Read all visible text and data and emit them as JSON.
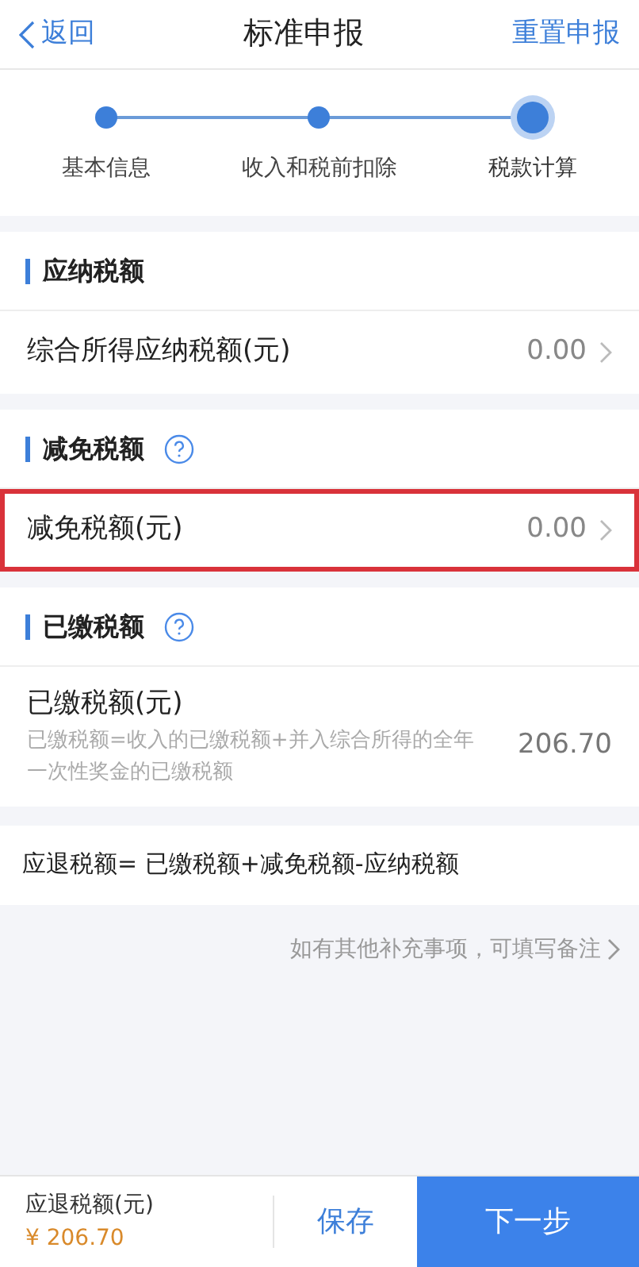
{
  "nav": {
    "back": "返回",
    "title": "标准申报",
    "action": "重置申报"
  },
  "steps": [
    {
      "label": "基本信息",
      "selected": false
    },
    {
      "label": "收入和税前扣除",
      "selected": false
    },
    {
      "label": "税款计算",
      "selected": true
    }
  ],
  "sections": [
    {
      "title": "应纳税额",
      "help": false,
      "rows": [
        {
          "kind": "link",
          "label": "综合所得应纳税额(元)",
          "value": "0.00",
          "highlighted": false
        }
      ]
    },
    {
      "title": "减免税额",
      "help": true,
      "rows": [
        {
          "kind": "link",
          "label": "减免税额(元)",
          "value": "0.00",
          "highlighted": true
        }
      ]
    },
    {
      "title": "已缴税额",
      "help": true,
      "rows": [
        {
          "kind": "detail",
          "label": "已缴税额(元)",
          "description": "已缴税额=收入的已缴税额+并入综合所得的全年一次性奖金的已缴税额",
          "value": "206.70",
          "highlighted": false
        }
      ]
    }
  ],
  "formula": "应退税额= 已缴税额+减免税额-应纳税额",
  "remark_link": "如有其他补充事项，可填写备注",
  "footer": {
    "label": "应退税额(元)",
    "amount": "¥ 206.70",
    "save": "保存",
    "next": "下一步"
  }
}
